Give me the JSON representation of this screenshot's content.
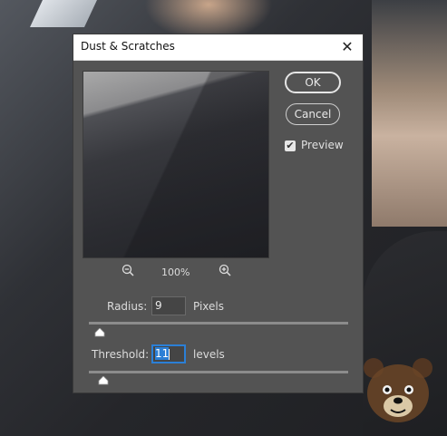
{
  "dialog": {
    "title": "Dust & Scratches",
    "close_glyph": "✕",
    "ok_label": "OK",
    "cancel_label": "Cancel",
    "preview_label": "Preview",
    "preview_checked": true,
    "zoom_level": "100%",
    "radius": {
      "label": "Radius:",
      "value": "9",
      "unit": "Pixels"
    },
    "threshold": {
      "label": "Threshold:",
      "value": "11",
      "unit": "levels"
    }
  },
  "icons": {
    "close": "close-icon",
    "zoom_out": "zoom-out-icon",
    "zoom_in": "zoom-in-icon",
    "check": "checkmark-icon"
  }
}
